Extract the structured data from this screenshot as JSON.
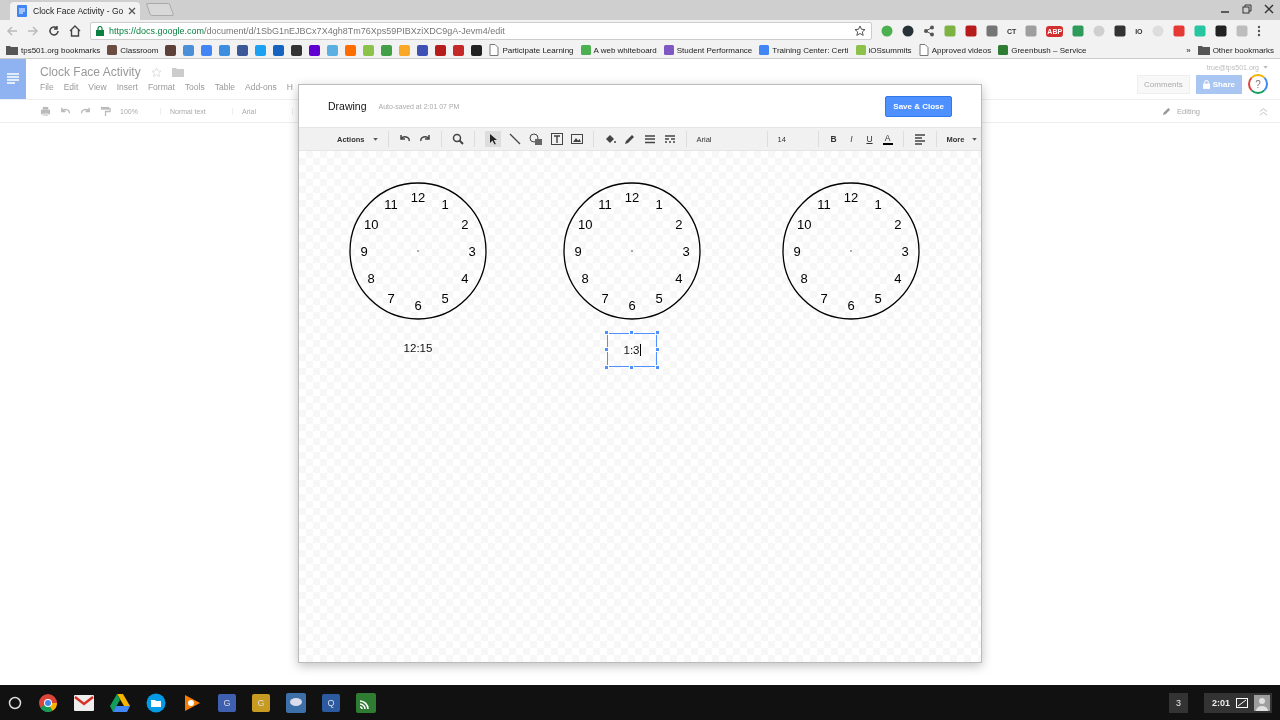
{
  "browser": {
    "tab": {
      "title": "Clock Face Activity - Go"
    },
    "url_host": "https://docs.google.com",
    "url_path": "/document/d/1SbG1nEJBCx7X4gh8Tm76Xps59PIBXziXDC9gA-Jevm4/edit",
    "extensions": [
      {
        "kind": "circle",
        "color": "#4caf50"
      },
      {
        "kind": "circle",
        "color": "#263238"
      },
      {
        "kind": "share",
        "color": "#555555"
      },
      {
        "kind": "square",
        "color": "#7cb342"
      },
      {
        "kind": "square",
        "color": "#b71c1c"
      },
      {
        "kind": "square",
        "color": "#757575"
      },
      {
        "kind": "text",
        "label": "CT"
      },
      {
        "kind": "square",
        "color": "#9e9e9e"
      },
      {
        "kind": "text",
        "label": "ABP",
        "color": "#d32f2f"
      },
      {
        "kind": "square",
        "color": "#2e9b5b"
      },
      {
        "kind": "circle",
        "color": "#cfcfcf"
      },
      {
        "kind": "square",
        "color": "#333333"
      },
      {
        "kind": "text",
        "label": "IO"
      },
      {
        "kind": "circle",
        "color": "#dddddd"
      },
      {
        "kind": "square",
        "color": "#e53935"
      },
      {
        "kind": "square",
        "color": "#26c6a0"
      },
      {
        "kind": "square",
        "color": "#222222"
      },
      {
        "kind": "square",
        "color": "#bdbdbd"
      }
    ],
    "bookmarks": [
      {
        "kind": "folder",
        "label": "tps501.org bookmarks"
      },
      {
        "kind": "app",
        "label": "Classroom",
        "color": "#6d4c41"
      },
      {
        "kind": "icon",
        "color": "#5d4037"
      },
      {
        "kind": "icon",
        "color": "#4a90d9"
      },
      {
        "kind": "icon",
        "color": "#4285f4"
      },
      {
        "kind": "icon",
        "color": "#3d8ee0"
      },
      {
        "kind": "icon",
        "color": "#3b5998"
      },
      {
        "kind": "icon",
        "color": "#1da1f2"
      },
      {
        "kind": "icon",
        "color": "#1565c0"
      },
      {
        "kind": "icon",
        "color": "#333333"
      },
      {
        "kind": "icon",
        "color": "#6001d2"
      },
      {
        "kind": "icon",
        "color": "#5ab0e0"
      },
      {
        "kind": "icon",
        "color": "#ff6d00"
      },
      {
        "kind": "icon",
        "color": "#8bc34a"
      },
      {
        "kind": "icon",
        "color": "#43a047"
      },
      {
        "kind": "icon",
        "color": "#f9a825"
      },
      {
        "kind": "icon",
        "color": "#3f51b5"
      },
      {
        "kind": "icon",
        "color": "#b71c1c"
      },
      {
        "kind": "icon",
        "color": "#c62828"
      },
      {
        "kind": "icon",
        "color": "#222222"
      },
      {
        "kind": "page",
        "label": "Participate Learning"
      },
      {
        "kind": "app",
        "label": "A web whiteboard",
        "color": "#4caf50"
      },
      {
        "kind": "app",
        "label": "Student Performance",
        "color": "#7e57c2"
      },
      {
        "kind": "app",
        "label": "Training Center: Certi",
        "color": "#4285f4"
      },
      {
        "kind": "app",
        "label": "iOSsummits",
        "color": "#8bc34a"
      },
      {
        "kind": "page",
        "label": "Approved videos"
      },
      {
        "kind": "app",
        "label": "Greenbush – Service",
        "color": "#2e7d32"
      }
    ],
    "bookmarks_overflow": "»",
    "other_bookmarks": "Other bookmarks"
  },
  "docs": {
    "title": "Clock Face Activity",
    "menus": [
      "File",
      "Edit",
      "View",
      "Insert",
      "Format",
      "Tools",
      "Table",
      "Add-ons",
      "H"
    ],
    "zoom": "100%",
    "style": "Normal text",
    "font": "Arial",
    "account": "true@tps501.org",
    "comments": "Comments",
    "share": "Share",
    "help": "?",
    "mode": "Editing"
  },
  "drawing": {
    "title": "Drawing",
    "status": "Auto-saved at 2:01 07 PM",
    "save": "Save & Close",
    "actions": "Actions",
    "font": "Arial",
    "size": "14",
    "format": [
      "B",
      "I",
      "U",
      "A"
    ],
    "more": "More",
    "clocks": [
      {
        "numbers": [
          "12",
          "1",
          "2",
          "3",
          "4",
          "5",
          "6",
          "7",
          "8",
          "9",
          "10",
          "11"
        ],
        "caption": "12:15",
        "editing": false
      },
      {
        "numbers": [
          "12",
          "1",
          "2",
          "3",
          "4",
          "5",
          "6",
          "7",
          "8",
          "9",
          "10",
          "11"
        ],
        "caption": "1:3",
        "editing": true
      },
      {
        "numbers": [
          "12",
          "1",
          "2",
          "3",
          "4",
          "5",
          "6",
          "7",
          "8",
          "9",
          "10",
          "11"
        ]
      }
    ]
  },
  "taskbar": {
    "apps": [
      {
        "kind": "chrome"
      },
      {
        "kind": "gmail"
      },
      {
        "kind": "drive"
      },
      {
        "kind": "files"
      },
      {
        "kind": "play"
      },
      {
        "kind": "letter",
        "label": "G",
        "color": "#3f5fb0"
      },
      {
        "kind": "letter",
        "label": "G",
        "color": "#c79a22"
      },
      {
        "kind": "chat",
        "color": "#3d6fa8"
      },
      {
        "kind": "letter",
        "label": "Q",
        "color": "#2c5aa0"
      },
      {
        "kind": "cast",
        "color": "#2e7d32"
      }
    ],
    "notifications": "3",
    "time": "2:01"
  }
}
